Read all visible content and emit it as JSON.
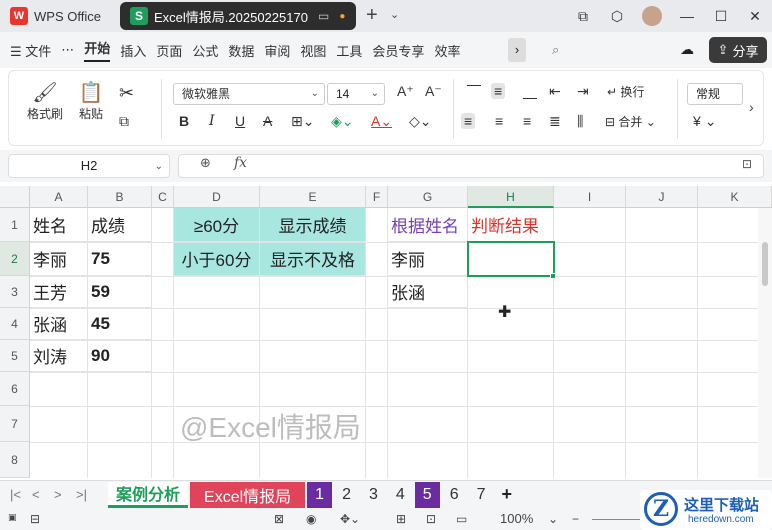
{
  "titlebar": {
    "app_tab": "WPS Office",
    "doc_tab": "Excel情报局.20250225170",
    "window_controls": [
      "tile-icon",
      "cube-icon",
      "avatar",
      "minimize-icon",
      "maximize-icon",
      "close-icon"
    ]
  },
  "menubar": {
    "file": "文件",
    "more": "⋯",
    "items": [
      "开始",
      "插入",
      "页面",
      "公式",
      "数据",
      "审阅",
      "视图",
      "工具",
      "会员专享",
      "效率"
    ],
    "share": "分享"
  },
  "ribbon": {
    "format_painter": "格式刷",
    "paste": "粘贴",
    "font_name": "微软雅黑",
    "font_size": "14",
    "wrap": "换行",
    "merge": "合并",
    "number_format": "常规",
    "currency": "¥"
  },
  "formula_bar": {
    "name_box": "H2",
    "fx": "fx",
    "formula": ""
  },
  "columns": [
    "A",
    "B",
    "C",
    "D",
    "E",
    "F",
    "G",
    "H",
    "I",
    "J",
    "K"
  ],
  "rows": [
    "1",
    "2",
    "3",
    "4",
    "5",
    "6",
    "7",
    "8"
  ],
  "cells": {
    "A1": "姓名",
    "B1": "成绩",
    "A2": "李丽",
    "B2": "75",
    "A3": "王芳",
    "B3": "59",
    "A4": "张涵",
    "B4": "45",
    "A5": "刘涛",
    "B5": "90",
    "D1": "≥60分",
    "E1": "显示成绩",
    "D2": "小于60分",
    "E2": "显示不及格",
    "G1": "根据姓名",
    "H1": "判断结果",
    "G2": "李丽",
    "G3": "张涵",
    "H2": ""
  },
  "watermark": "@Excel情报局",
  "sheet_tabs": {
    "nav": [
      "|<",
      "<",
      ">",
      ">|"
    ],
    "tabs": [
      "案例分析",
      "Excel情报局",
      "1",
      "2",
      "3",
      "4",
      "5",
      "6",
      "7"
    ],
    "add": "+"
  },
  "statusbar": {
    "zoom": "100%"
  },
  "brand": {
    "logo_letter": "Z",
    "title": "这里下载站",
    "url": "heredown.com"
  },
  "colors": {
    "accent_green": "#1e9e5a",
    "teal_fill": "#a8e6e0",
    "header_purple": "#7a3fb5",
    "header_red": "#d9342b",
    "tab_red": "#e0445a",
    "tab_purple": "#6a2ca0"
  }
}
